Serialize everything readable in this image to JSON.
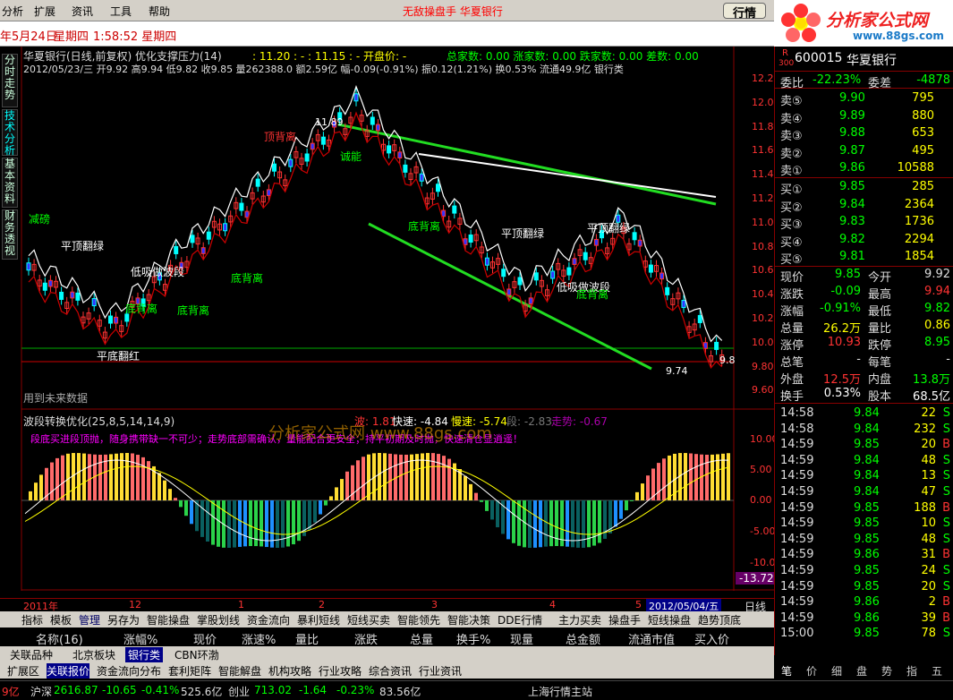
{
  "menu": [
    "分析",
    "扩展",
    "资讯",
    "工具",
    "帮助"
  ],
  "menu_center": "无敌操盘手  华夏银行",
  "quote_button": "行情",
  "datetime": {
    "date": "年5月24日",
    "weekday": "星期四",
    "time": "1:58:52 星期四"
  },
  "logo": {
    "title": "分析家公式网",
    "url": "www.88gs.com"
  },
  "side_tabs": [
    "分时走势",
    "技术分析",
    "基本资料",
    "财务透视"
  ],
  "chart": {
    "title": "华夏银行(日线,前复权) 优化支撑压力(14)",
    "vals": ": 11.20 : - : 11.15 : - 开盘价: -",
    "stats_line": "总家数: 0.00  涨家数: 0.00  跌家数: 0.00  差数: 0.00",
    "bar_info": "2012/05/23/三 开9.92 高9.94 低9.82 收9.85 量262388.0 额2.59亿 幅-0.09(-0.91%) 振0.12(1.21%) 换0.53% 流通49.9亿 银行类",
    "note": "用到未来数据",
    "price_labels": [
      "12.20",
      "12.00",
      "11.80",
      "11.60",
      "11.40",
      "11.20",
      "11.00",
      "10.80",
      "10.60",
      "10.40",
      "10.20",
      "10.00",
      "9.80",
      "9.60"
    ],
    "annotations": {
      "a1": "顶背离",
      "a2": "11.89",
      "a3": "平顶翻绿",
      "a4": "低吸做波段",
      "a5": "底背离",
      "a6": "底背离",
      "a7": "底背离",
      "a8": "平底翻红",
      "a9": "平顶翻绿",
      "a10": "平顶翻绿",
      "a11": "低吸做波段",
      "a12": "底背离",
      "a13": "9.74",
      "a14": "9.8",
      "a15": "底背离",
      "a16": "减磅",
      "a17": "诚能"
    },
    "ind_title": "波段转换优化(25,8,5,14,14,9)",
    "ind_vals": {
      "bo": "波: 1.81",
      "kuai": "快速: -4.84",
      "man": "慢速: -5.74",
      "duan": "段: -2.83",
      "zou": "走势: -0.67"
    },
    "ind_note": "段底买进段顶抛，随身携带缺一不可少；走势底部需确认，量能配合更安全；持平初期及时抛，快速清仓显逍遥！",
    "watermark": "分析家公式网 www.88gs.com",
    "ind_labels": [
      "10.00",
      "5.00",
      "0.00",
      "-5.00",
      "-10.00"
    ],
    "ind_current": "-13.72",
    "time_axis": [
      "2011年",
      "12",
      "1",
      "2",
      "3",
      "4",
      "5",
      "2012/05/04/五"
    ],
    "period": "日线",
    "up_color": "#ff3333",
    "down_color": "#00ffff",
    "ma_color": "#ffffff",
    "trend_color": "#00ff00"
  },
  "toolbar": [
    "指标",
    "模板",
    "管理",
    "另存为",
    "智能操盘",
    "掌股划线",
    "资金流向",
    "暴利短线",
    "短线买卖",
    "智能领先",
    "智能决策",
    "DDE行情",
    "主力买卖",
    "操盘手",
    "短线操盘",
    "趋势顶底"
  ],
  "columns": [
    "名称(16)",
    "涨幅%",
    "现价",
    "涨速%",
    "量比",
    "涨跌",
    "总量",
    "换手%",
    "现量",
    "总金额",
    "流通市值",
    "买入价"
  ],
  "cat_tabs": [
    "关联品种",
    "北京板块",
    "银行类",
    "CBN环渤"
  ],
  "bottom_tabs": [
    "扩展区",
    "关联报价",
    "资金流向分布",
    "套利矩阵",
    "智能解盘",
    "机构攻略",
    "行业攻略",
    "综合资讯",
    "行业资讯"
  ],
  "status": {
    "sh": "沪深",
    "sh_val": "2616.87",
    "sh_chg": "-10.65",
    "sh_pct": "-0.41%",
    "sh_amt": "525.6亿",
    "cy": "创业",
    "cy_val": "713.02",
    "cy_chg": "-1.64",
    "cy_pct": "-0.23%",
    "cy_amt": "83.56亿",
    "left": "9亿",
    "server": "上海行情主站"
  },
  "stock": {
    "code": "600015",
    "name": "华夏银行",
    "r": "R",
    "num": "300",
    "weibi_label": "委比",
    "weibi": "-22.23%",
    "weicha_label": "委差",
    "weicha": "-4878",
    "sells": [
      {
        "l": "卖⑤",
        "p": "9.90",
        "v": "795"
      },
      {
        "l": "卖④",
        "p": "9.89",
        "v": "880"
      },
      {
        "l": "卖③",
        "p": "9.88",
        "v": "653"
      },
      {
        "l": "卖②",
        "p": "9.87",
        "v": "495"
      },
      {
        "l": "卖①",
        "p": "9.86",
        "v": "10588"
      }
    ],
    "buys": [
      {
        "l": "买①",
        "p": "9.85",
        "v": "285"
      },
      {
        "l": "买②",
        "p": "9.84",
        "v": "2364"
      },
      {
        "l": "买③",
        "p": "9.83",
        "v": "1736"
      },
      {
        "l": "买④",
        "p": "9.82",
        "v": "2294"
      },
      {
        "l": "买⑤",
        "p": "9.81",
        "v": "1854"
      }
    ],
    "info": [
      {
        "l1": "现价",
        "v1": "9.85",
        "l2": "今开",
        "v2": "9.92"
      },
      {
        "l1": "涨跌",
        "v1": "-0.09",
        "l2": "最高",
        "v2": "9.94"
      },
      {
        "l1": "涨幅",
        "v1": "-0.91%",
        "l2": "最低",
        "v2": "9.82"
      },
      {
        "l1": "总量",
        "v1": "26.2万",
        "l2": "量比",
        "v2": "0.86"
      },
      {
        "l1": "涨停",
        "v1": "10.93",
        "l2": "跌停",
        "v2": "8.95"
      },
      {
        "l1": "总笔",
        "v1": "-",
        "l2": "每笔",
        "v2": "-"
      },
      {
        "l1": "外盘",
        "v1": "12.5万",
        "l2": "内盘",
        "v2": "13.8万"
      },
      {
        "l1": "换手",
        "v1": "0.53%",
        "l2": "股本",
        "v2": "68.5亿"
      }
    ],
    "ticks": [
      {
        "t": "14:58",
        "p": "9.84",
        "v": "22",
        "s": "S"
      },
      {
        "t": "14:58",
        "p": "9.84",
        "v": "232",
        "s": "S"
      },
      {
        "t": "14:59",
        "p": "9.85",
        "v": "20",
        "s": "B"
      },
      {
        "t": "14:59",
        "p": "9.84",
        "v": "48",
        "s": "S"
      },
      {
        "t": "14:59",
        "p": "9.84",
        "v": "13",
        "s": "S"
      },
      {
        "t": "14:59",
        "p": "9.84",
        "v": "47",
        "s": "S"
      },
      {
        "t": "14:59",
        "p": "9.85",
        "v": "188",
        "s": "B"
      },
      {
        "t": "14:59",
        "p": "9.85",
        "v": "10",
        "s": "S"
      },
      {
        "t": "14:59",
        "p": "9.85",
        "v": "48",
        "s": "S"
      },
      {
        "t": "14:59",
        "p": "9.86",
        "v": "31",
        "s": "B"
      },
      {
        "t": "14:59",
        "p": "9.85",
        "v": "24",
        "s": "S"
      },
      {
        "t": "14:59",
        "p": "9.85",
        "v": "20",
        "s": "S"
      },
      {
        "t": "14:59",
        "p": "9.86",
        "v": "2",
        "s": "B"
      },
      {
        "t": "14:59",
        "p": "9.86",
        "v": "39",
        "s": "B"
      },
      {
        "t": "15:00",
        "p": "9.85",
        "v": "78",
        "s": "S"
      }
    ],
    "rp_tabs": [
      "笔",
      "价",
      "细",
      "盘",
      "势",
      "指",
      "五"
    ]
  }
}
